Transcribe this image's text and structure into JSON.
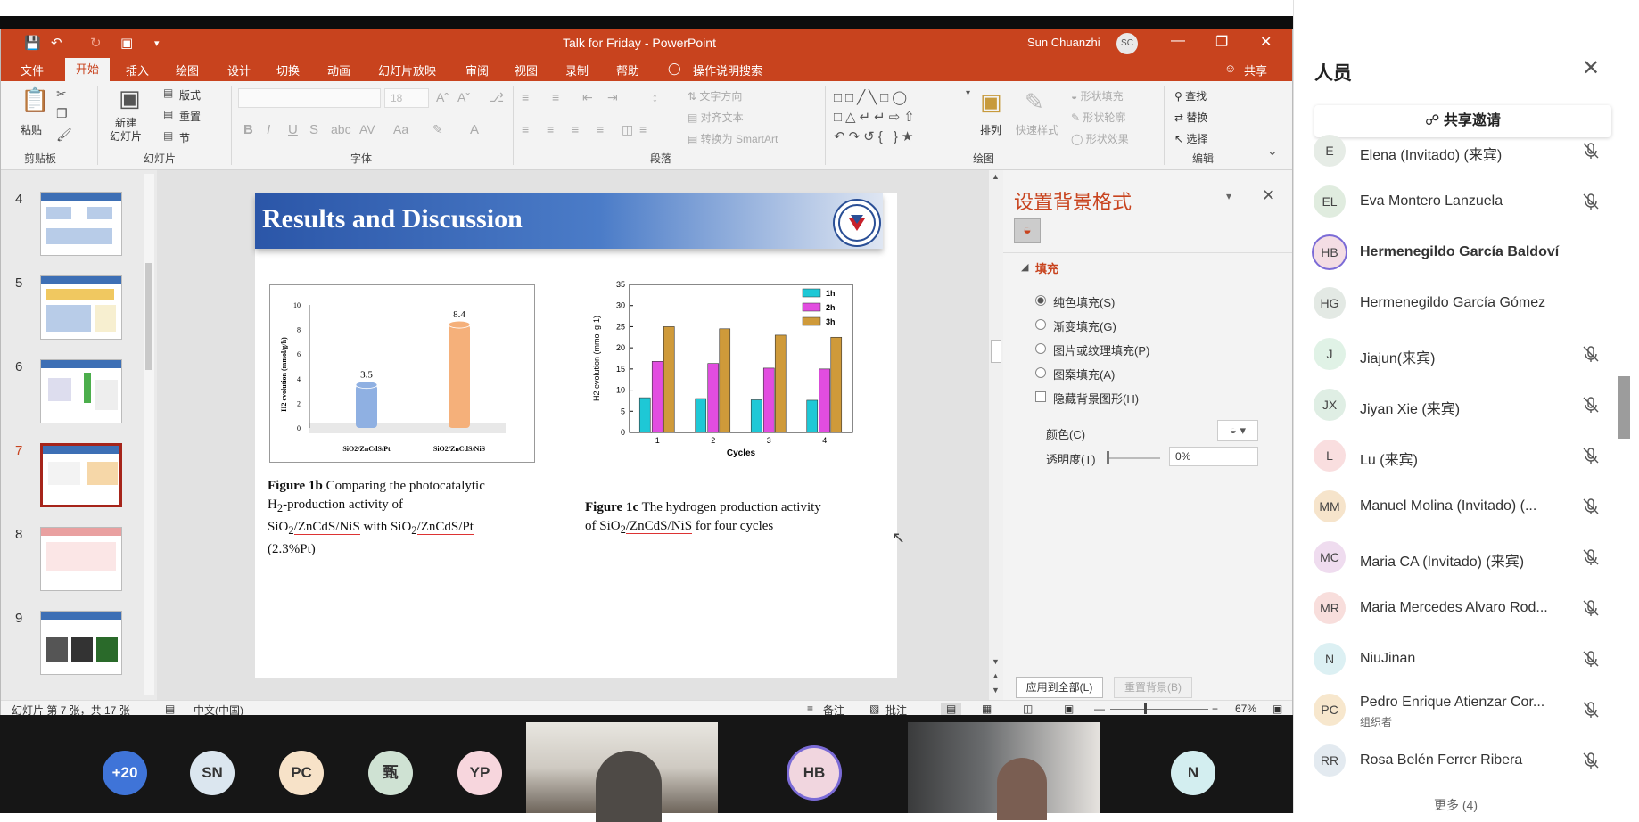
{
  "window": {
    "doc_title": "Talk for Friday",
    "app_name": "PowerPoint",
    "title_sep": "-",
    "user_name": "Sun Chuanzhi",
    "user_initials": "SC"
  },
  "menu": [
    "文件",
    "开始",
    "插入",
    "绘图",
    "设计",
    "切换",
    "动画",
    "幻灯片放映",
    "审阅",
    "视图",
    "录制",
    "帮助"
  ],
  "menu_active": "开始",
  "tell_me": "操作说明搜索",
  "share_label": "共享",
  "ribbon": {
    "paste": "粘贴",
    "clipboard_group": "剪贴板",
    "new_slide": "新建\n幻灯片",
    "layout": "版式",
    "reset": "重置",
    "section": "节",
    "slides_group": "幻灯片",
    "font_size": "18",
    "font_group": "字体",
    "text_direction": "文字方向",
    "align_text": "对齐文本",
    "smartart": "转换为 SmartArt",
    "paragraph_group": "段落",
    "arrange": "排列",
    "quick_styles": "快速样式",
    "shape_fill": "形状填充",
    "shape_outline": "形状轮廓",
    "shape_effects": "形状效果",
    "drawing_group": "绘图",
    "find": "查找",
    "replace": "替换",
    "select": "选择",
    "editing_group": "编辑"
  },
  "thumbnails": [
    {
      "num": "4"
    },
    {
      "num": "5"
    },
    {
      "num": "6"
    },
    {
      "num": "7"
    },
    {
      "num": "8"
    },
    {
      "num": "9"
    }
  ],
  "slide": {
    "title": "Results and Discussion",
    "fig1b_label": "Figure 1b",
    "fig1b_text_a": "Comparing the photocatalytic",
    "fig1b_text_b": "H",
    "fig1b_text_b_sub": "2",
    "fig1b_text_c": "-production activity of",
    "fig1b_text_d": "SiO",
    "fig1b_text_d_sub": "2",
    "fig1b_text_e": "/ZnCdS/NiS",
    "fig1b_text_f": " with SiO",
    "fig1b_text_f_sub": "2",
    "fig1b_text_g": "/ZnCdS/Pt",
    "fig1b_text_h": "(2.3%Pt)",
    "fig1c_label": "Figure 1c",
    "fig1c_text_a": "The hydrogen production activity",
    "fig1c_text_b": "of SiO",
    "fig1c_text_b_sub": "2",
    "fig1c_text_c": "/ZnCdS/NiS",
    "fig1c_text_d": " for four cycles"
  },
  "chart_data": [
    {
      "type": "bar",
      "categories": [
        "SiO2/ZnCdS/Pt",
        "SiO2/ZnCdS/NiS"
      ],
      "values": [
        3.5,
        8.4
      ],
      "value_labels": [
        "3.5",
        "8.4"
      ],
      "ylabel": "H2 evolution (mmol/g/h)",
      "ylim": [
        0,
        10
      ],
      "yticks": [
        "0",
        "2",
        "4",
        "6",
        "8",
        "10"
      ],
      "colors": [
        "#8fb0e2",
        "#f5b07a"
      ]
    },
    {
      "type": "bar",
      "categories": [
        "1",
        "2",
        "3",
        "4"
      ],
      "series": [
        {
          "name": "1h",
          "values": [
            8.2,
            8.0,
            7.7,
            7.6
          ],
          "color": "#1ec8d6"
        },
        {
          "name": "2h",
          "values": [
            16.8,
            16.3,
            15.2,
            15.0
          ],
          "color": "#e24de0"
        },
        {
          "name": "3h",
          "values": [
            25.0,
            24.5,
            23.0,
            22.5
          ],
          "color": "#cf9a3a"
        }
      ],
      "xlabel": "Cycles",
      "ylabel": "H2 evolution (mmol g-1)",
      "ylim": [
        0,
        35
      ],
      "yticks": [
        "0",
        "5",
        "10",
        "15",
        "20",
        "25",
        "30",
        "35"
      ],
      "legend": "top-right"
    }
  ],
  "format_pane": {
    "title": "设置背景格式",
    "section": "填充",
    "options": [
      "纯色填充(S)",
      "渐变填充(G)",
      "图片或纹理填充(P)",
      "图案填充(A)"
    ],
    "selected_option": 0,
    "hide_bg": "隐藏背景图形(H)",
    "color_label": "颜色(C)",
    "transparency_label": "透明度(T)",
    "transparency_value": "0%",
    "apply_all": "应用到全部(L)",
    "reset_bg": "重置背景(B)"
  },
  "statusbar": {
    "slide_info": "幻灯片 第 7 张，共 17 张",
    "language": "中文(中国)",
    "notes": "备注",
    "comments": "批注",
    "zoom": "67%"
  },
  "video_tiles": [
    {
      "label": "+20",
      "color": "#3f74d8"
    },
    {
      "label": "SN",
      "color": "#dbe6ef"
    },
    {
      "label": "PC",
      "color": "#f7e2c8"
    },
    {
      "label": "甄",
      "color": "#cfe2d3"
    },
    {
      "label": "YP",
      "color": "#f7d6dd"
    },
    {
      "label": "HB",
      "color": "#f1d6df"
    },
    {
      "label": "N",
      "color": "#d3eef0"
    }
  ],
  "panel": {
    "title": "人员",
    "share_invite": "共享邀请",
    "more": "更多 (4)",
    "participants": [
      {
        "initials": "E",
        "name": "Elena (Invitado) (来宾)",
        "role": "",
        "color": "#e6ece6",
        "muted": true
      },
      {
        "initials": "EL",
        "name": "Eva Montero Lanzuela",
        "role": "",
        "color": "#e0ecdf",
        "muted": true
      },
      {
        "initials": "HB",
        "name": "Hermenegildo García Baldoví",
        "role": "",
        "color": "#f4dde4",
        "muted": false
      },
      {
        "initials": "HG",
        "name": "Hermenegildo García Gómez",
        "role": "",
        "color": "#e3e9e4",
        "muted": false
      },
      {
        "initials": "J",
        "name": "Jiajun(来宾)",
        "role": "",
        "color": "#e0f2e6",
        "muted": true
      },
      {
        "initials": "JX",
        "name": "Jiyan Xie (来宾)",
        "role": "",
        "color": "#dfeee4",
        "muted": true
      },
      {
        "initials": "L",
        "name": "Lu (来宾)",
        "role": "",
        "color": "#f9dedf",
        "muted": true
      },
      {
        "initials": "MM",
        "name": "Manuel Molina (Invitado) (...",
        "role": "",
        "color": "#f6e4cb",
        "muted": true
      },
      {
        "initials": "MC",
        "name": "Maria CA (Invitado) (来宾)",
        "role": "",
        "color": "#efdcef",
        "muted": true
      },
      {
        "initials": "MR",
        "name": "Maria Mercedes Alvaro Rod...",
        "role": "",
        "color": "#f8dedc",
        "muted": true
      },
      {
        "initials": "N",
        "name": "NiuJinan",
        "role": "",
        "color": "#dcf0f3",
        "muted": true
      },
      {
        "initials": "PC",
        "name": "Pedro Enrique Atienzar Cor...",
        "role": "组织者",
        "color": "#f7e7cd",
        "muted": true
      },
      {
        "initials": "RR",
        "name": "Rosa Belén Ferrer Ribera",
        "role": "",
        "color": "#e3eaf0",
        "muted": true
      }
    ]
  }
}
